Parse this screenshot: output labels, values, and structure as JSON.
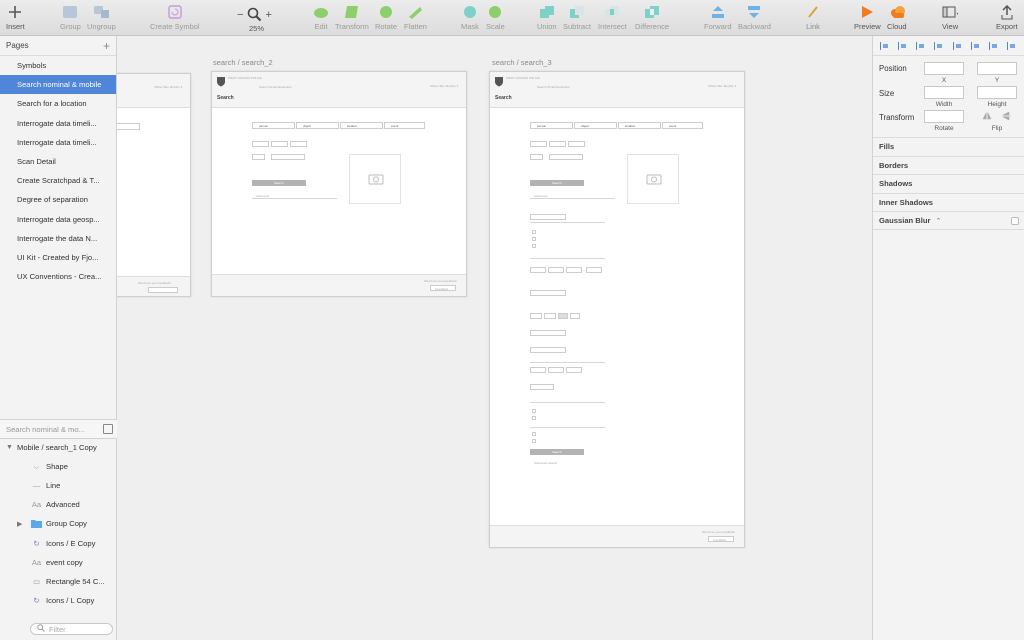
{
  "toolbar": {
    "insert": "Insert",
    "group": "Group",
    "ungroup": "Ungroup",
    "create_symbol": "Create Symbol",
    "zoom": "25%",
    "zoom_minus": "−",
    "zoom_plus": "+",
    "edit": "Edit",
    "transform": "Transform",
    "rotate": "Rotate",
    "flatten": "Flatten",
    "mask": "Mask",
    "scale": "Scale",
    "union": "Union",
    "subtract": "Subtract",
    "intersect": "Intersect",
    "difference": "Difference",
    "forward": "Forward",
    "backward": "Backward",
    "link": "Link",
    "preview": "Preview",
    "cloud": "Cloud",
    "view": "View",
    "export": "Export"
  },
  "pages": {
    "header": "Pages",
    "add": "+",
    "items": [
      "Symbols",
      "Search nominal & mobile",
      "Search for a location",
      "Interrogate data timeli...",
      "Interrogate data timeli...",
      "Scan Detail",
      "Create Scratchpad & T...",
      "Degree of separation",
      "Interrogate data geosp...",
      "Interrogate the data N...",
      "UI Kit  - Created by Fjo...",
      "UX Conventions - Crea..."
    ]
  },
  "layer_search": "Search nominal & mo...",
  "layers": [
    {
      "label": "Mobile / search_1 Copy",
      "icon": "▼",
      "type": "artboard"
    },
    {
      "label": "Shape",
      "icon": "⌵",
      "type": "shape"
    },
    {
      "label": "Line",
      "icon": "—",
      "type": "line"
    },
    {
      "label": "Advanced",
      "icon": "Aa",
      "type": "text"
    },
    {
      "label": "Group Copy",
      "icon": "▶",
      "type": "group"
    },
    {
      "label": "Icons / E Copy",
      "icon": "↻",
      "type": "symbol"
    },
    {
      "label": "event copy",
      "icon": "Aa",
      "type": "text"
    },
    {
      "label": "Rectangle 54 C...",
      "icon": "▭",
      "type": "rect"
    },
    {
      "label": "Icons / L Copy",
      "icon": "↻",
      "type": "symbol"
    }
  ],
  "filter_placeholder": "Filter",
  "artboards": {
    "ab2_title": "search / search_2",
    "ab3_title": "search / search_3",
    "logo_text": "WEST\nHIGGINS\nPOLICE",
    "nav": "Search   Scratchpad   Help",
    "user": "Officer Ben Murphy  ▾",
    "heading": "Search",
    "tabs": [
      "person",
      "object",
      "location",
      "event"
    ],
    "search_btn": "Search",
    "advanced": "Advanced",
    "footer_btn": "Feedback",
    "footer_text": "We'd love your feedback",
    "advanced_search": "Advanced search"
  },
  "inspector": {
    "position": "Position",
    "x": "X",
    "y": "Y",
    "size": "Size",
    "width": "Width",
    "height": "Height",
    "transform": "Transform",
    "rotate": "Rotate",
    "flip": "Flip",
    "fills": "Fills",
    "borders": "Borders",
    "shadows": "Shadows",
    "inner_shadows": "Inner Shadows",
    "gaussian_blur": "Gaussian Blur"
  },
  "colors": {
    "selection": "#4f86d9",
    "preview": "#f07c1e",
    "cloud": "#f07c1e",
    "green_tools": "#8dcf6c",
    "teal_tools": "#7fd0c9",
    "blue_tools": "#6fb3e6"
  }
}
